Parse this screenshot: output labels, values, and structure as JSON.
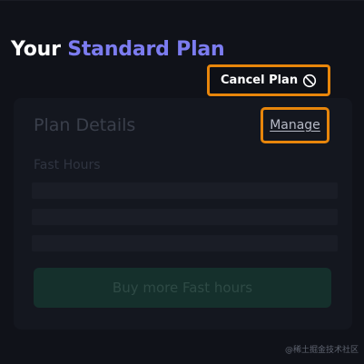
{
  "heading": {
    "prefix": "Your",
    "plan_name": "Standard Plan"
  },
  "card": {
    "title": "Plan Details",
    "fast_hours_label": "Fast Hours",
    "buy_button_label": "Buy more Fast hours"
  },
  "popup": {
    "cancel_label": "Cancel Plan",
    "cancel_icon": "ban-icon"
  },
  "manage_link": "Manage",
  "watermark": "@稀土掘金技术社区",
  "colors": {
    "accent": "#7c7cf0",
    "highlight": "#e8860b",
    "background": "#101219"
  }
}
